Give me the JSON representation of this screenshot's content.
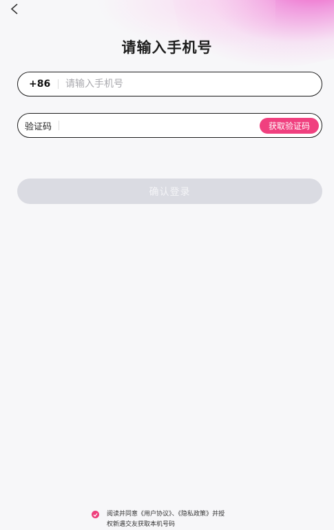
{
  "header": {
    "title": "请输入手机号"
  },
  "phone": {
    "prefix": "+86",
    "placeholder": "请输入手机号",
    "value": ""
  },
  "code": {
    "label": "验证码",
    "value": "",
    "get_code_label": "获取验证码"
  },
  "submit": {
    "label": "确认登录"
  },
  "agreement": {
    "prefix": "阅读并同意",
    "user_agreement": "《用户协议》",
    "separator": "、",
    "privacy_policy": "《隐私政策》",
    "suffix_line1": "并授",
    "line2": "权新遇交友获取本机号码",
    "checked": true
  },
  "colors": {
    "accent": "#f0407f",
    "disabled_button": "#dadbe2",
    "background": "#f7f7f9"
  },
  "icons": {
    "back": "chevron-left-icon",
    "check": "checkmark-icon"
  }
}
